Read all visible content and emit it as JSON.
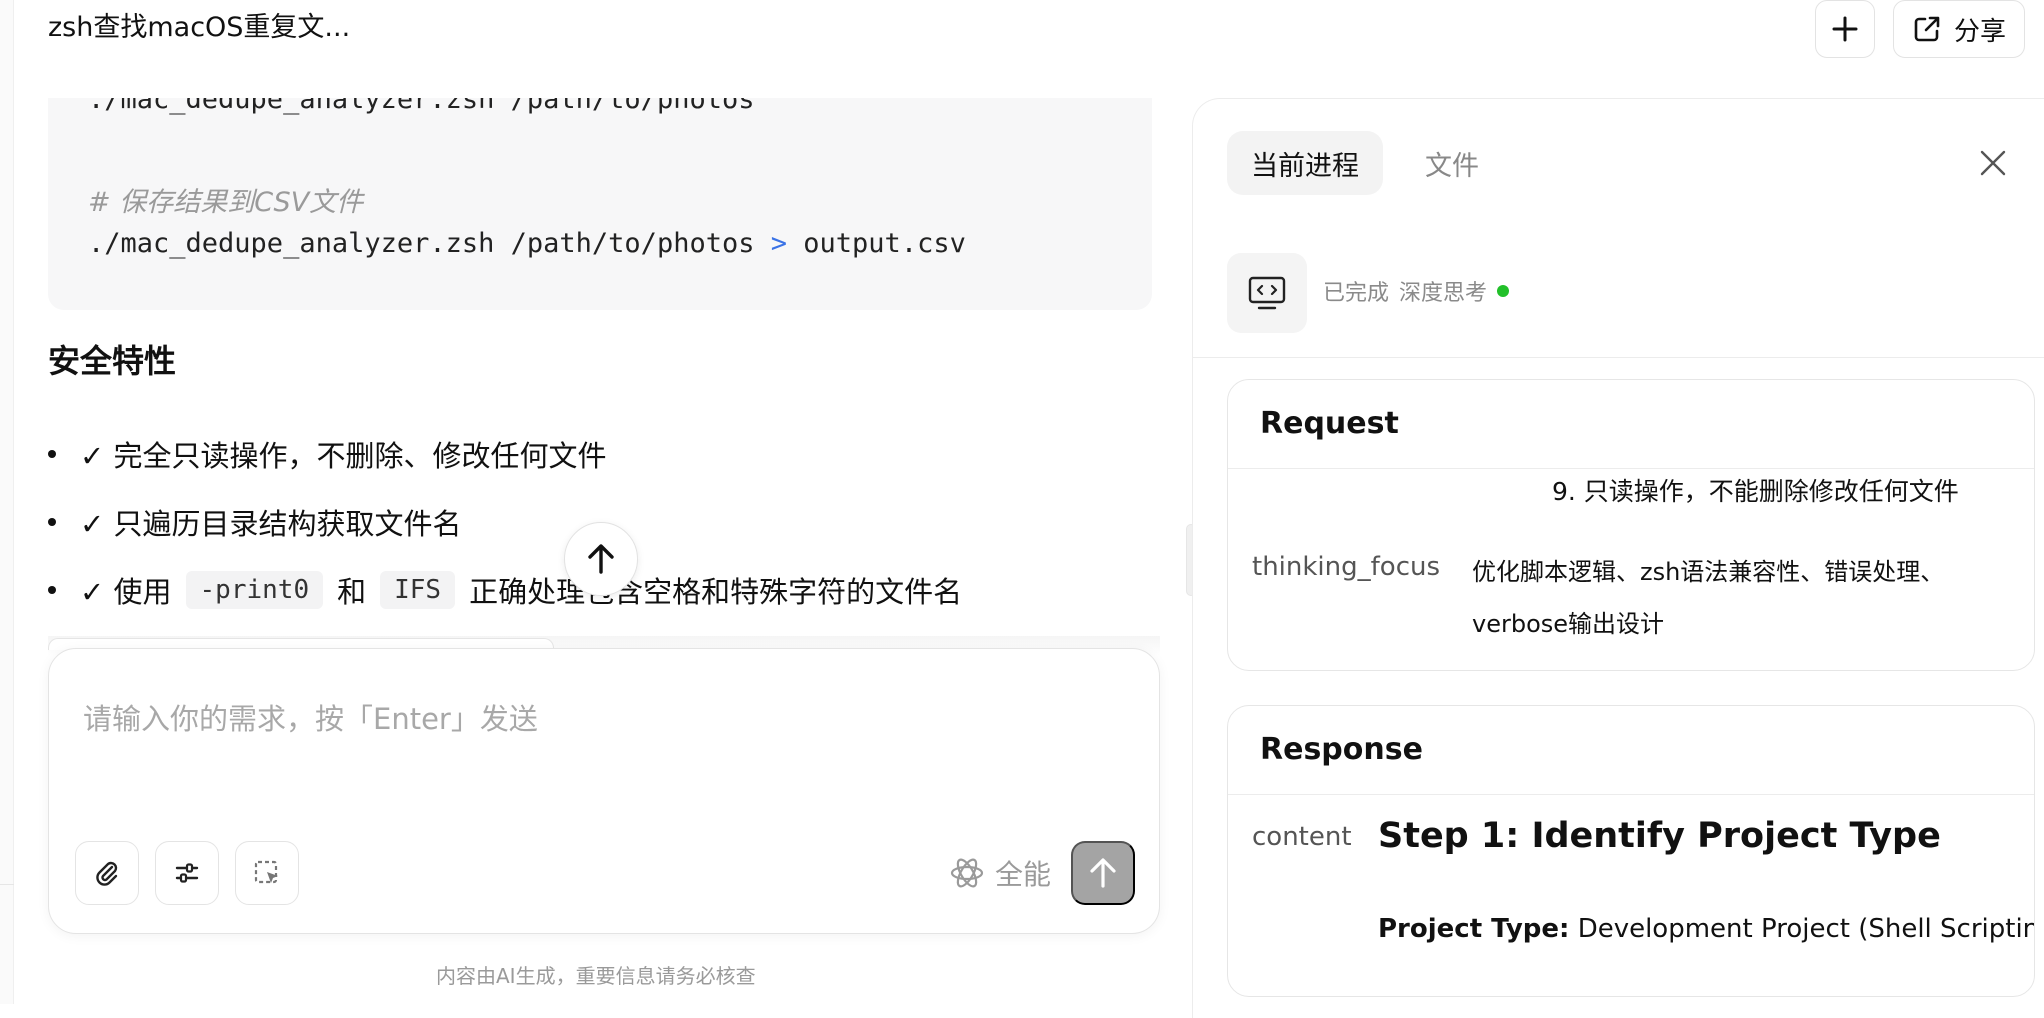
{
  "header": {
    "conversation_title": "zsh查找macOS重复文...",
    "share_label": "分享"
  },
  "code_block": {
    "line_1": "./mac_dedupe_analyzer.zsh /path/to/photos",
    "comment": "# 保存结果到CSV文件",
    "line_2_cmd": "./mac_dedupe_analyzer.zsh /path/to/photos",
    "line_2_op": ">",
    "line_2_target": "output.csv"
  },
  "content": {
    "section_heading": "安全特性",
    "bullets": {
      "item_1": "✓ 完全只读操作，不删除、修改任何文件",
      "item_2": "✓ 只遍历目录结构获取文件名",
      "item_3_prefix": "✓ 使用",
      "item_3_code_1": "-print0",
      "item_3_mid": "和",
      "item_3_code_2": "IFS",
      "item_3_suffix": "正确处理包含空格和特殊字符的文件名"
    }
  },
  "input": {
    "placeholder": "请输入你的需求，按「Enter」发送",
    "value": "",
    "mode_label": "全能",
    "disclaimer": "内容由AI生成，重要信息请务必核查"
  },
  "panel": {
    "tabs": {
      "progress": "当前进程",
      "files": "文件"
    },
    "status": {
      "state": "已完成",
      "label": "深度思考"
    },
    "request": {
      "title": "Request",
      "item_9": "9.  只读操作，不能删除修改任何文件",
      "key": "thinking_focus",
      "value": "优化脚本逻辑、zsh语法兼容性、错误处理、verbose输出设计"
    },
    "response": {
      "title": "Response",
      "key": "content",
      "heading": "Step 1: Identify Project Type",
      "line_label": "Project Type:",
      "line_value": "Development Project (Shell Scripting/C"
    }
  },
  "colors": {
    "status_dot": "#22c02a",
    "code_operator": "#3b73e6",
    "send_button": "#a4a4a4"
  }
}
